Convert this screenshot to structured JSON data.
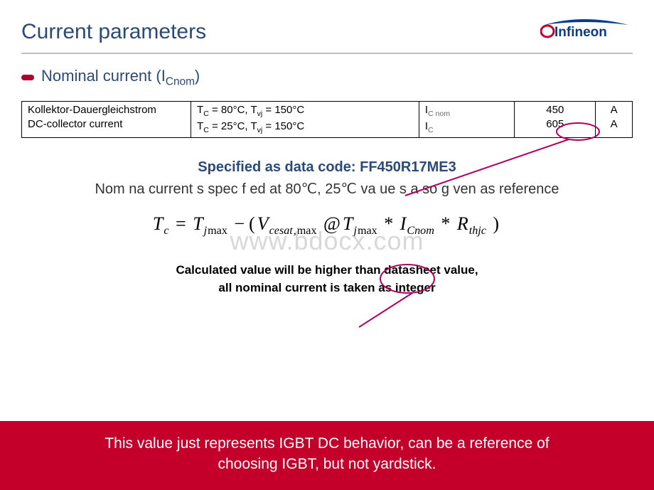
{
  "header": {
    "title": "Current parameters",
    "brand": "Infineon"
  },
  "bullet": {
    "label_pre": "Nominal current (I",
    "label_sub": "Cnom",
    "label_post": ")"
  },
  "table": {
    "param_de": "Kollektor-Dauergleichstrom",
    "param_en": "DC-collector current",
    "cond1_pre": "T",
    "cond1_c_sub": "C",
    "cond1_mid": " = 80°C, T",
    "cond1_vj_sub": "vj",
    "cond1_post": " = 150°C",
    "cond2_pre": "T",
    "cond2_c_sub": "C",
    "cond2_mid": " = 25°C, T",
    "cond2_vj_sub": "vj",
    "cond2_post": " = 150°C",
    "sym1_pre": "I",
    "sym1_sub": "C nom",
    "sym2_pre": "I",
    "sym2_sub": "C",
    "val1": "450",
    "val2": "605",
    "unit1": "A",
    "unit2": "A"
  },
  "spec_line": "Specified as data code: FF450R17ME3",
  "note_line": "Nom na  current  s spec f ed at 80℃, 25℃ va ue  s a so g ven as reference",
  "formula": {
    "Tc_T": "T",
    "Tc_sub": "c",
    "eq": "=",
    "Tj1_T": "T",
    "Tj1_sub": "j",
    "Tj1_max": "max",
    "minus": "−",
    "lpar": "(",
    "V": "V",
    "V_sub": "cesat",
    "V_comma": ",",
    "V_max": "max",
    "at": "@",
    "Tj2_T": "T",
    "Tj2_sub": "j",
    "Tj2_max": "max",
    "star1": "*",
    "I": "I",
    "I_sub": "Cnom",
    "star2": "*",
    "R": "R",
    "R_sub": "thjc",
    "rpar": ")"
  },
  "watermark": "www.bdocx.com",
  "calc_note_l1": "Calculated value will be higher than datasheet value,",
  "calc_note_l2": "all nominal current is taken as integer",
  "footer_l1": "This value just represents IGBT DC behavior, can be a reference of",
  "footer_l2": "choosing IGBT, but not yardstick."
}
